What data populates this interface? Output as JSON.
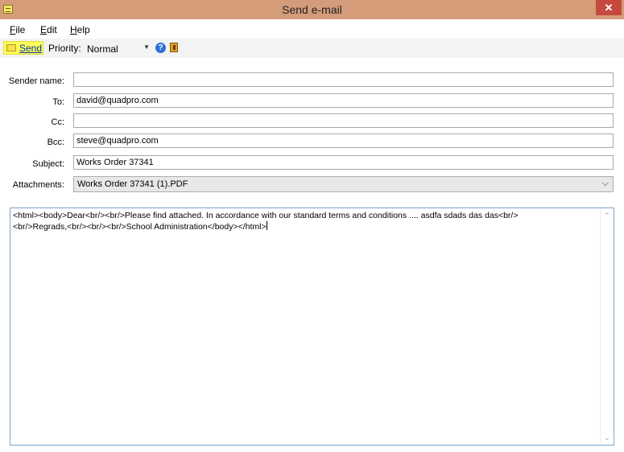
{
  "window": {
    "title": "Send e-mail",
    "close_glyph": "✕"
  },
  "menu": [
    "File",
    "Edit",
    "Help"
  ],
  "toolbar": {
    "send_label": "Send",
    "priority_label": "Priority:",
    "priority_value": "Normal",
    "help_glyph": "?"
  },
  "form": {
    "sender_label": "Sender name:",
    "sender_value": "",
    "to_label": "To:",
    "to_value": "david@quadpro.com",
    "cc_label": "Cc:",
    "cc_value": "",
    "bcc_label": "Bcc:",
    "bcc_value": "steve@quadpro.com",
    "subject_label": "Subject:",
    "subject_value": "Works Order 37341",
    "attachments_label": "Attachments:",
    "attachments_value": "Works Order 37341 (1).PDF"
  },
  "body": {
    "text": "<html><body>Dear<br/><br/>Please find attached. In accordance with our standard terms and conditions .... asdfa sdads das das<br/>\n<br/>Regrads,<br/><br/><br/>School Administration</body></html>"
  },
  "colors": {
    "titlebar": "#d49c79",
    "close": "#c7493d",
    "send_highlight": "#fffe5a",
    "body_border": "#7da2ce"
  }
}
